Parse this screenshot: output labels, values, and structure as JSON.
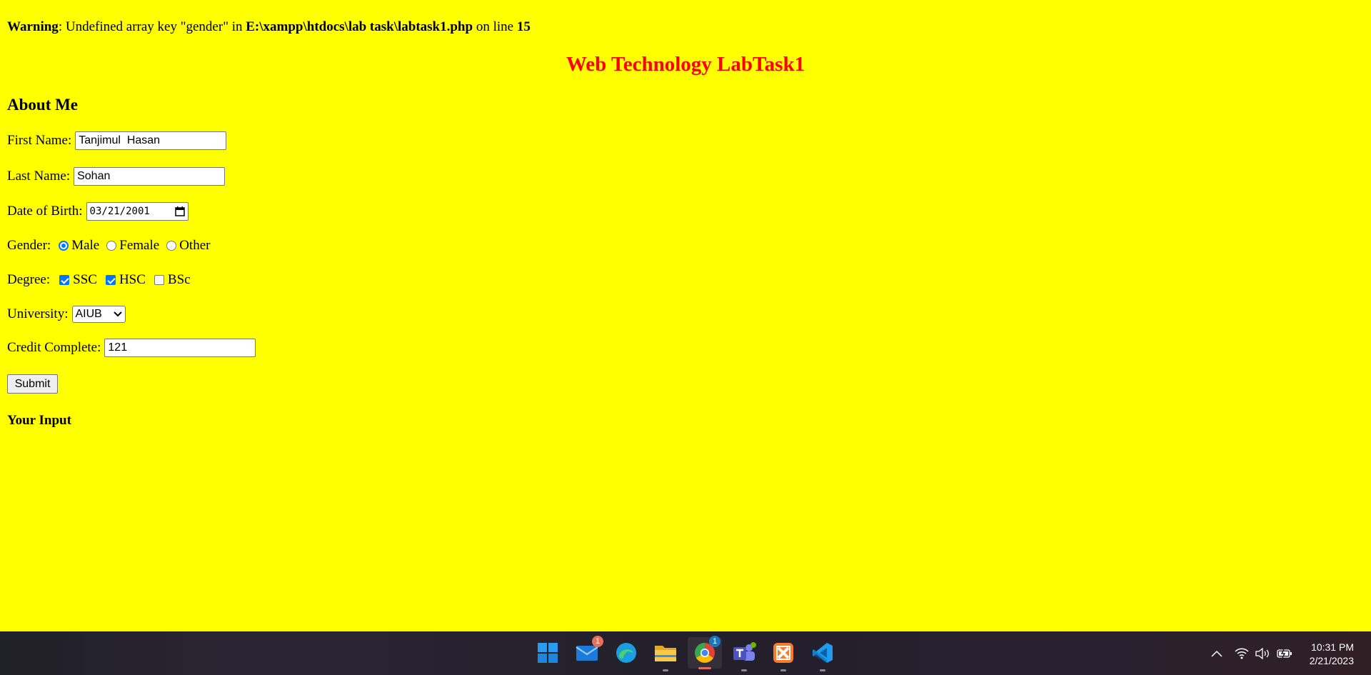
{
  "warning": {
    "prefix": "Warning",
    "message": ": Undefined array key \"gender\" in ",
    "path": "E:\\xampp\\htdocs\\lab task\\labtask1.php",
    "on_line": " on line ",
    "line": "15"
  },
  "page_title": "Web Technology LabTask1",
  "section_title": "About Me",
  "form": {
    "first_name": {
      "label": "First Name:",
      "value": "Tanjimul  Hasan"
    },
    "last_name": {
      "label": "Last Name:",
      "value": "Sohan"
    },
    "dob": {
      "label": "Date of Birth:",
      "value": "03/21/2001"
    },
    "gender": {
      "label": "Gender:",
      "options": [
        {
          "label": "Male",
          "checked": true
        },
        {
          "label": "Female",
          "checked": false
        },
        {
          "label": "Other",
          "checked": false
        }
      ]
    },
    "degree": {
      "label": "Degree:",
      "options": [
        {
          "label": "SSC",
          "checked": true
        },
        {
          "label": "HSC",
          "checked": true
        },
        {
          "label": "BSc",
          "checked": false
        }
      ]
    },
    "university": {
      "label": "University:",
      "selected": "AIUB"
    },
    "credit": {
      "label": "Credit Complete:",
      "value": "121"
    },
    "submit_label": "Submit"
  },
  "output_title": "Your Input",
  "colors": {
    "page_bg": "#ffff00",
    "title": "#ff0000",
    "accent": "#0075ff"
  },
  "taskbar": {
    "apps": [
      {
        "name": "start-icon"
      },
      {
        "name": "mail-icon",
        "badge": "1"
      },
      {
        "name": "edge-icon"
      },
      {
        "name": "file-explorer-icon"
      },
      {
        "name": "chrome-icon",
        "badge": "1"
      },
      {
        "name": "teams-icon"
      },
      {
        "name": "xampp-icon"
      },
      {
        "name": "vscode-icon"
      }
    ],
    "tray": [
      "chevron-up-icon",
      "wifi-icon",
      "volume-icon",
      "battery-icon"
    ],
    "time": "10:31 PM",
    "date": "2/21/2023"
  }
}
